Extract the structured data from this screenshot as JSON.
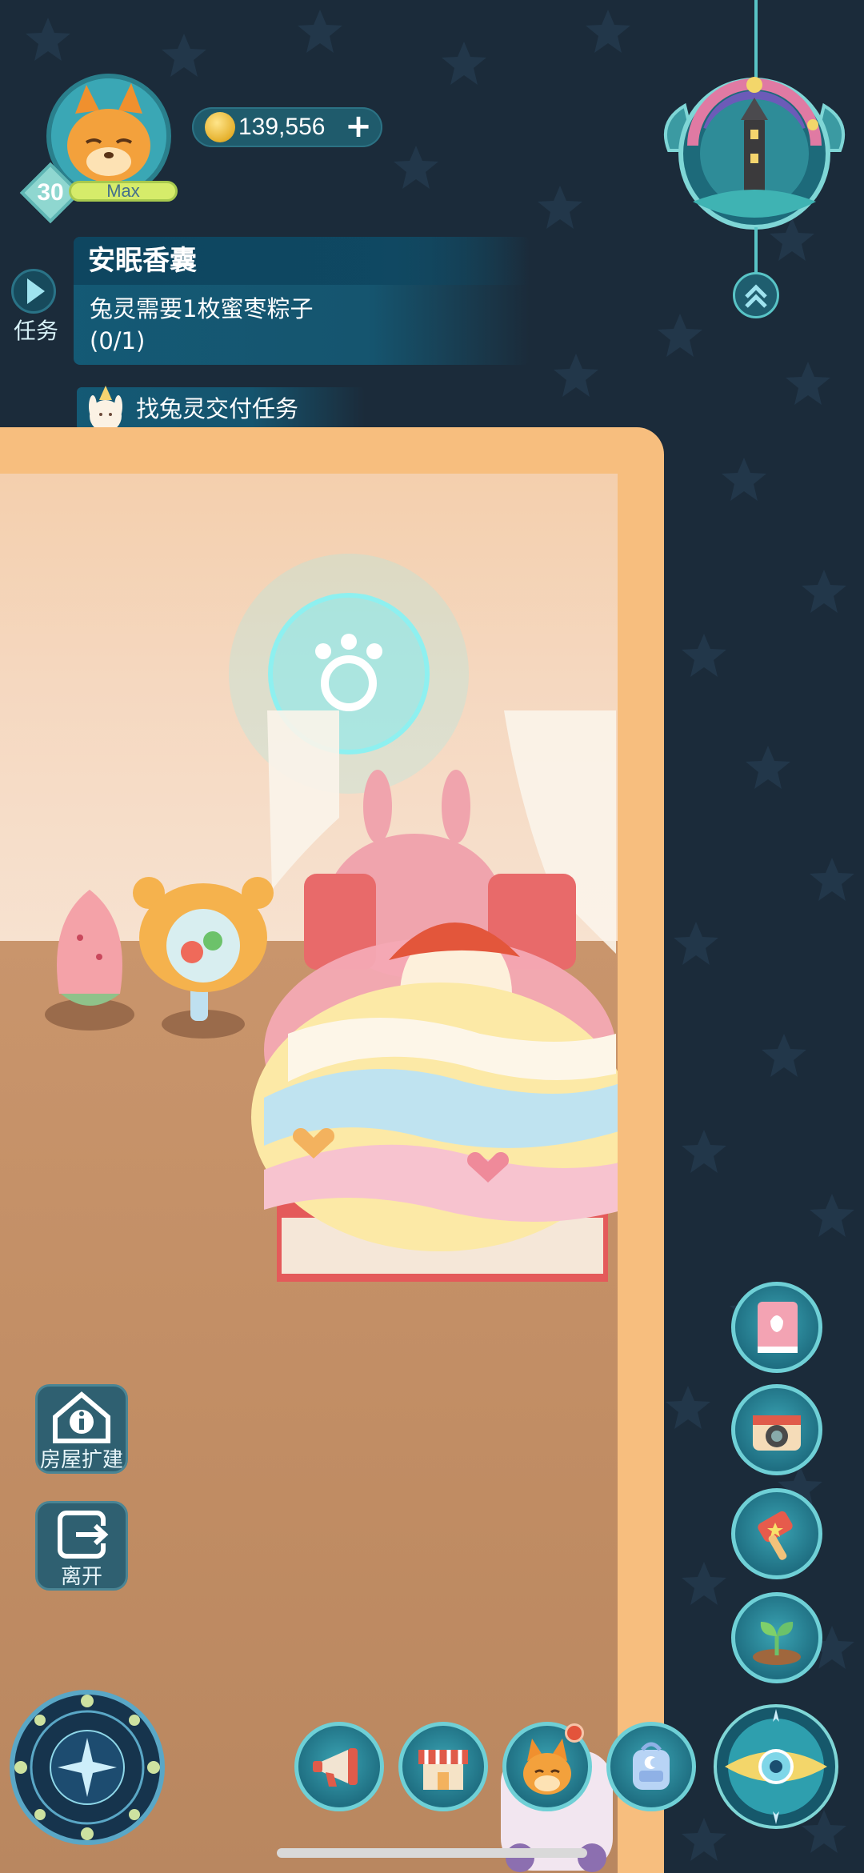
{
  "player": {
    "level": "30",
    "level_status": "Max",
    "coins": "139,556",
    "add_coins_label": "+"
  },
  "quest": {
    "side_label": "任务",
    "title": "安眠香囊",
    "description": "兔灵需要1枚蜜枣粽子",
    "progress": "(0/1)",
    "deliver_text": "找兔灵交付任务"
  },
  "room_buttons": {
    "expand_label": "房屋扩建",
    "leave_label": "离开"
  },
  "icons": {
    "coin": "coin-icon",
    "add": "plus-icon",
    "quest_toggle": "play-triangle-icon",
    "clock": "day-night-clock-icon",
    "collapse": "double-chevron-up-icon",
    "album": "tulip-book-icon",
    "camera": "camera-icon",
    "hammer": "hammer-icon",
    "sprout": "sprout-icon",
    "compass": "compass-icon",
    "megaphone": "megaphone-icon",
    "shop": "shop-icon",
    "pet": "fox-icon",
    "backpack": "backpack-icon",
    "main_orb": "eye-orb-icon"
  },
  "colors": {
    "background": "#1b2b3a",
    "room_frame": "#f7be7e",
    "accent_teal": "#59c4c6",
    "quest_panel": "#145c78",
    "notification": "#e3543b"
  }
}
